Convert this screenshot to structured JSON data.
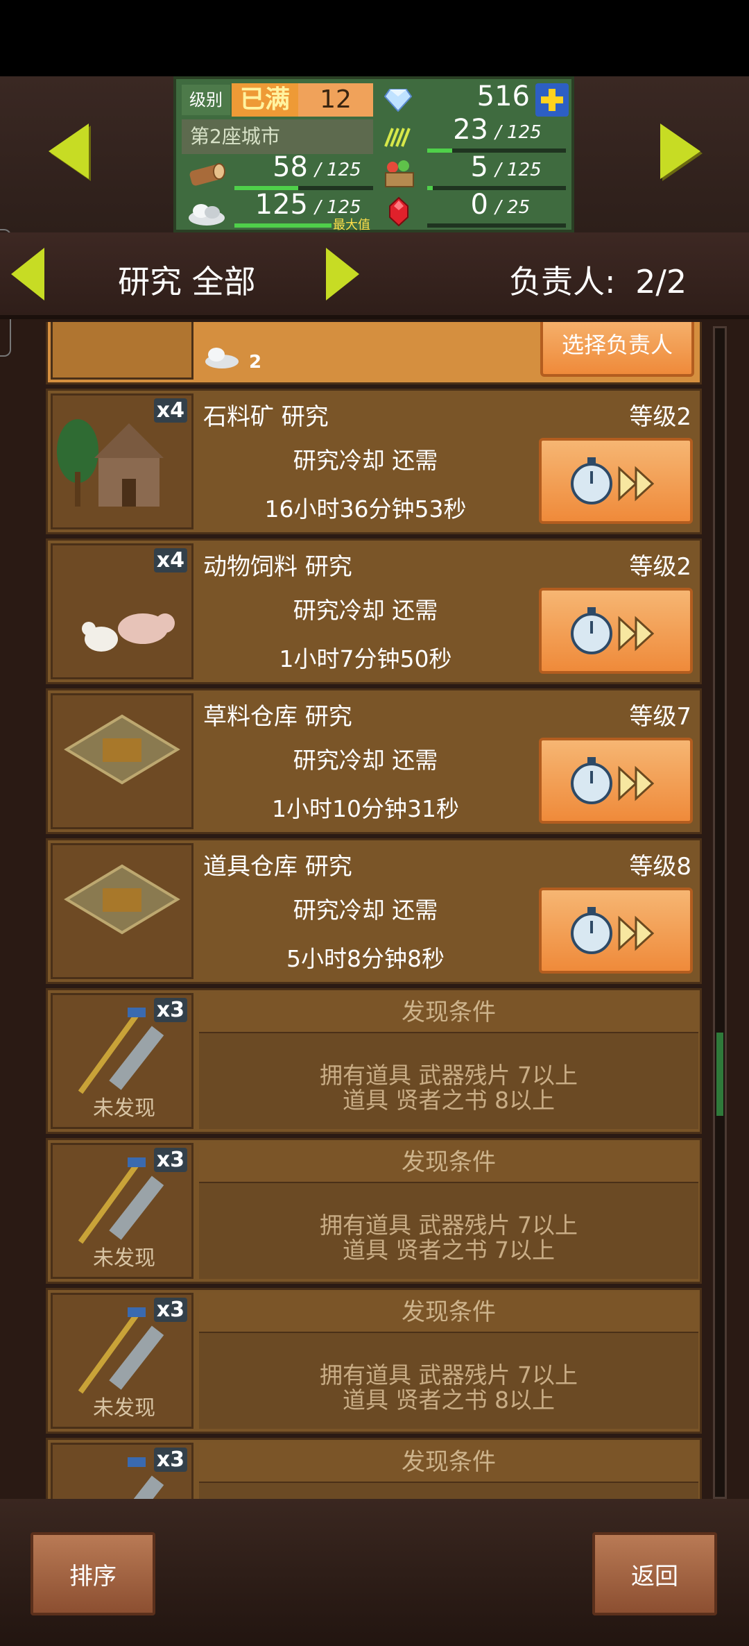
{
  "resources": {
    "level_label": "级别",
    "level_status": "已满",
    "level_value": "12",
    "gems": "516",
    "city_name": "第2座城市",
    "grass": "23",
    "grass_max": "/ 125",
    "wood": "58",
    "wood_max": "/ 125",
    "food": "5",
    "food_max": "/ 125",
    "stone": "125",
    "stone_max": "/ 125",
    "stone_note": "最大值",
    "ruby": "0",
    "ruby_max": "/ 25"
  },
  "tab": {
    "title": "研究 全部",
    "assignee_label": "负责人:",
    "assignee_value": "2/2"
  },
  "partial_row": {
    "button_label": "选择负责人",
    "stone_count": "2"
  },
  "research_rows": [
    {
      "title": "石料矿 研究",
      "level": "等级2",
      "status": "研究冷却 还需",
      "time": "16小时36分钟53秒",
      "multiplier": "x4",
      "image": "house-icon"
    },
    {
      "title": "动物饲料 研究",
      "level": "等级2",
      "status": "研究冷却 还需",
      "time": "1小时7分钟50秒",
      "multiplier": "x4",
      "image": "animals-icon"
    },
    {
      "title": "草料仓库 研究",
      "level": "等级7",
      "status": "研究冷却 还需",
      "time": "1小时10分钟31秒",
      "multiplier": "",
      "image": "warehouse-icon"
    },
    {
      "title": "道具仓库 研究",
      "level": "等级8",
      "status": "研究冷却 还需",
      "time": "5小时8分钟8秒",
      "multiplier": "",
      "image": "warehouse-icon"
    }
  ],
  "locked_rows": [
    {
      "header": "发现条件",
      "line1": "拥有道具 武器残片 7以上",
      "line2": "道具 贤者之书 8以上",
      "multiplier": "x3",
      "label": "未发现"
    },
    {
      "header": "发现条件",
      "line1": "拥有道具 武器残片 7以上",
      "line2": "道具 贤者之书 7以上",
      "multiplier": "x3",
      "label": "未发现"
    },
    {
      "header": "发现条件",
      "line1": "拥有道具 武器残片 7以上",
      "line2": "道具 贤者之书 8以上",
      "multiplier": "x3",
      "label": "未发现"
    },
    {
      "header": "发现条件",
      "line1": "",
      "line2": "",
      "multiplier": "x3",
      "label": ""
    }
  ],
  "bottom": {
    "sort_label": "排序",
    "back_label": "返回"
  },
  "colors": {
    "accent_arrow": "#c7dc24",
    "button_orange": "#ef8a3a",
    "panel_green": "#3f6b3f"
  }
}
